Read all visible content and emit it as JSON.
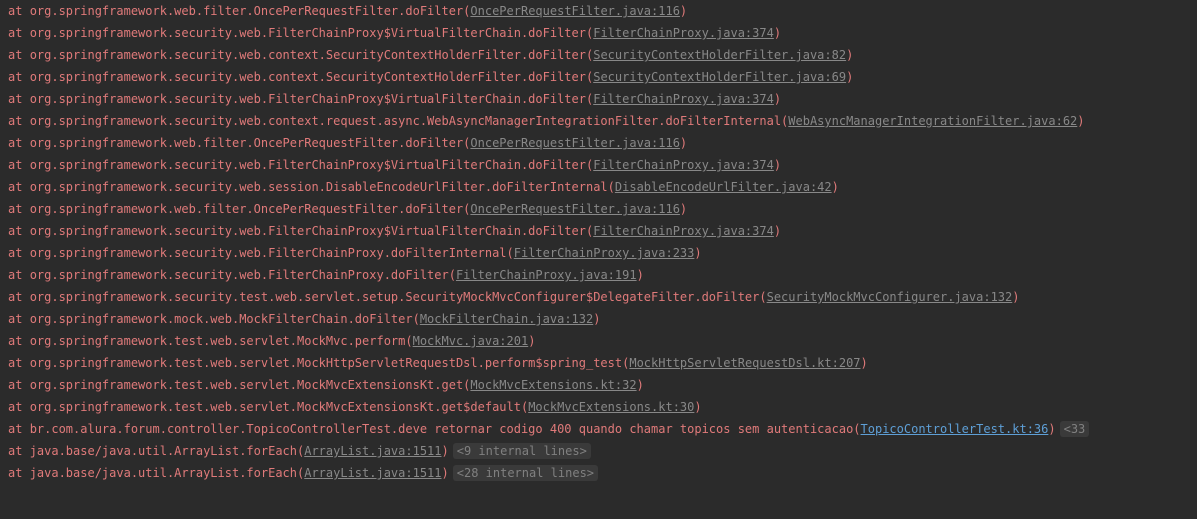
{
  "lines": [
    {
      "prefix": "at ",
      "method": "org.springframework.web.filter.OncePerRequestFilter.doFilter",
      "linkText": "OncePerRequestFilter.java:116",
      "linkClass": "link"
    },
    {
      "prefix": "at ",
      "method": "org.springframework.security.web.FilterChainProxy$VirtualFilterChain.doFilter",
      "linkText": "FilterChainProxy.java:374",
      "linkClass": "link"
    },
    {
      "prefix": "at ",
      "method": "org.springframework.security.web.context.SecurityContextHolderFilter.doFilter",
      "linkText": "SecurityContextHolderFilter.java:82",
      "linkClass": "link"
    },
    {
      "prefix": "at ",
      "method": "org.springframework.security.web.context.SecurityContextHolderFilter.doFilter",
      "linkText": "SecurityContextHolderFilter.java:69",
      "linkClass": "link"
    },
    {
      "prefix": "at ",
      "method": "org.springframework.security.web.FilterChainProxy$VirtualFilterChain.doFilter",
      "linkText": "FilterChainProxy.java:374",
      "linkClass": "link"
    },
    {
      "prefix": "at ",
      "method": "org.springframework.security.web.context.request.async.WebAsyncManagerIntegrationFilter.doFilterInternal",
      "linkText": "WebAsyncManagerIntegrationFilter.java:62",
      "linkClass": "link"
    },
    {
      "prefix": "at ",
      "method": "org.springframework.web.filter.OncePerRequestFilter.doFilter",
      "linkText": "OncePerRequestFilter.java:116",
      "linkClass": "link"
    },
    {
      "prefix": "at ",
      "method": "org.springframework.security.web.FilterChainProxy$VirtualFilterChain.doFilter",
      "linkText": "FilterChainProxy.java:374",
      "linkClass": "link"
    },
    {
      "prefix": "at ",
      "method": "org.springframework.security.web.session.DisableEncodeUrlFilter.doFilterInternal",
      "linkText": "DisableEncodeUrlFilter.java:42",
      "linkClass": "link"
    },
    {
      "prefix": "at ",
      "method": "org.springframework.web.filter.OncePerRequestFilter.doFilter",
      "linkText": "OncePerRequestFilter.java:116",
      "linkClass": "link"
    },
    {
      "prefix": "at ",
      "method": "org.springframework.security.web.FilterChainProxy$VirtualFilterChain.doFilter",
      "linkText": "FilterChainProxy.java:374",
      "linkClass": "link"
    },
    {
      "prefix": "at ",
      "method": "org.springframework.security.web.FilterChainProxy.doFilterInternal",
      "linkText": "FilterChainProxy.java:233",
      "linkClass": "link"
    },
    {
      "prefix": "at ",
      "method": "org.springframework.security.web.FilterChainProxy.doFilter",
      "linkText": "FilterChainProxy.java:191",
      "linkClass": "link"
    },
    {
      "prefix": "at ",
      "method": "org.springframework.security.test.web.servlet.setup.SecurityMockMvcConfigurer$DelegateFilter.doFilter",
      "linkText": "SecurityMockMvcConfigurer.java:132",
      "linkClass": "link"
    },
    {
      "prefix": "at ",
      "method": "org.springframework.mock.web.MockFilterChain.doFilter",
      "linkText": "MockFilterChain.java:132",
      "linkClass": "link"
    },
    {
      "prefix": "at ",
      "method": "org.springframework.test.web.servlet.MockMvc.perform",
      "linkText": "MockMvc.java:201",
      "linkClass": "link"
    },
    {
      "prefix": "at ",
      "method": "org.springframework.test.web.servlet.MockHttpServletRequestDsl.perform$spring_test",
      "linkText": "MockHttpServletRequestDsl.kt:207",
      "linkClass": "link"
    },
    {
      "prefix": "at ",
      "method": "org.springframework.test.web.servlet.MockMvcExtensionsKt.get",
      "linkText": "MockMvcExtensions.kt:32",
      "linkClass": "link"
    },
    {
      "prefix": "at ",
      "method": "org.springframework.test.web.servlet.MockMvcExtensionsKt.get$default",
      "linkText": "MockMvcExtensions.kt:30",
      "linkClass": "link"
    },
    {
      "prefix": "at ",
      "method": "br.com.alura.forum.controller.TopicoControllerTest.deve retornar codigo 400 quando chamar topicos sem autenticacao",
      "linkText": "TopicoControllerTest.kt:36",
      "linkClass": "link-highlight",
      "suffix": "<33"
    },
    {
      "prefix": "at ",
      "method": "java.base/java.util.ArrayList.forEach",
      "linkText": "ArrayList.java:1511",
      "linkClass": "link",
      "internal": "<9 internal lines>"
    },
    {
      "prefix": "at ",
      "method": "java.base/java.util.ArrayList.forEach",
      "linkText": "ArrayList.java:1511",
      "linkClass": "link",
      "internal": "<28 internal lines>"
    }
  ]
}
